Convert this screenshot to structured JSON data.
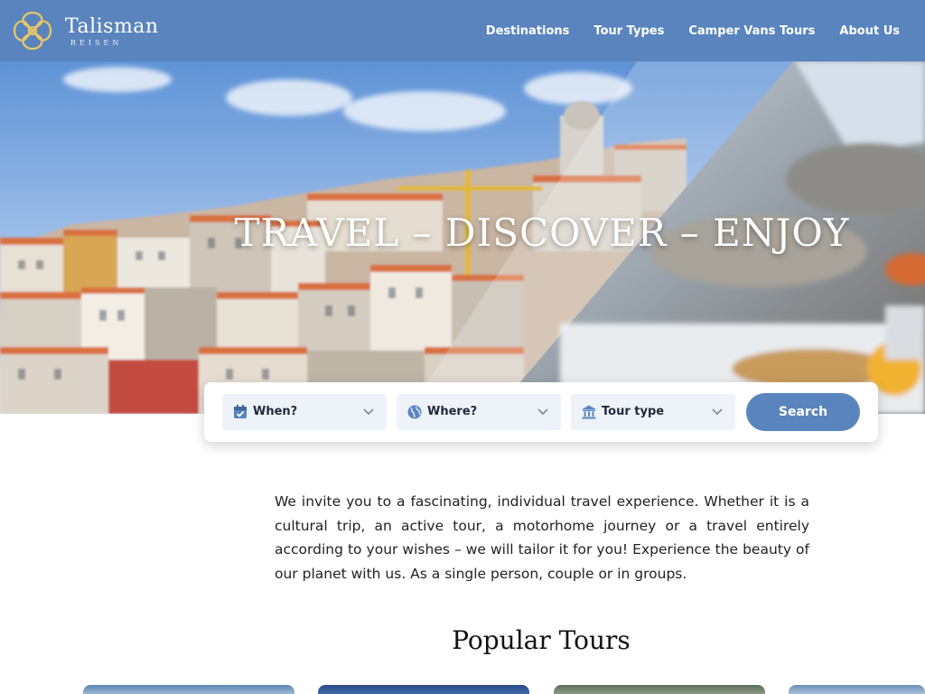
{
  "header": {
    "brand_name": "Talisman",
    "brand_sub": "REISEN",
    "nav": [
      {
        "label": "Destinations"
      },
      {
        "label": "Tour Types"
      },
      {
        "label": "Camper Vans Tours"
      },
      {
        "label": "About Us"
      }
    ]
  },
  "hero": {
    "title": "TRAVEL – DISCOVER – ENJOY"
  },
  "search": {
    "when_label": "When?",
    "where_label": "Where?",
    "tour_type_label": "Tour type",
    "search_label": "Search"
  },
  "intro": {
    "text": "We invite you to a fascinating, individual travel experience. Whether it is a cultural trip, an active tour, a motorhome journey or a travel entirely according to your wishes – we will tailor it for you! Experience the beauty of our planet with us. As a single person, couple or in groups."
  },
  "popular": {
    "title": "Popular Tours"
  },
  "colors": {
    "brand_blue": "#5a84bd",
    "field_bg": "#eef3fa",
    "logo_gold": "#e8c766"
  }
}
